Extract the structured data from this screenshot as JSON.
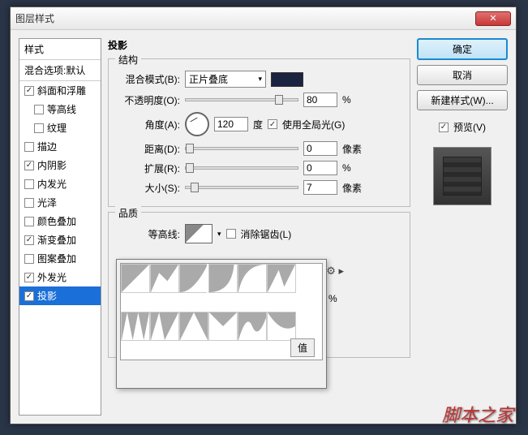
{
  "dialog": {
    "title": "图层样式"
  },
  "styles_panel": {
    "header": "样式",
    "blend_options": "混合选项:默认",
    "items": [
      {
        "label": "斜面和浮雕",
        "checked": true,
        "indent": false
      },
      {
        "label": "等高线",
        "checked": false,
        "indent": true
      },
      {
        "label": "纹理",
        "checked": false,
        "indent": true
      },
      {
        "label": "描边",
        "checked": false,
        "indent": false
      },
      {
        "label": "内阴影",
        "checked": true,
        "indent": false
      },
      {
        "label": "内发光",
        "checked": false,
        "indent": false
      },
      {
        "label": "光泽",
        "checked": false,
        "indent": false
      },
      {
        "label": "颜色叠加",
        "checked": false,
        "indent": false
      },
      {
        "label": "渐变叠加",
        "checked": true,
        "indent": false
      },
      {
        "label": "图案叠加",
        "checked": false,
        "indent": false
      },
      {
        "label": "外发光",
        "checked": true,
        "indent": false
      },
      {
        "label": "投影",
        "checked": true,
        "indent": false,
        "selected": true
      }
    ]
  },
  "center": {
    "title": "投影",
    "structure": {
      "legend": "结构",
      "blend_mode_label": "混合模式(B):",
      "blend_mode_value": "正片叠底",
      "opacity_label": "不透明度(O):",
      "opacity_value": "80",
      "opacity_unit": "%",
      "angle_label": "角度(A):",
      "angle_value": "120",
      "angle_unit": "度",
      "use_global_light": "使用全局光(G)",
      "use_global_checked": true,
      "distance_label": "距离(D):",
      "distance_value": "0",
      "distance_unit": "像素",
      "spread_label": "扩展(R):",
      "spread_value": "0",
      "spread_unit": "%",
      "size_label": "大小(S):",
      "size_value": "7",
      "size_unit": "像素"
    },
    "quality": {
      "legend": "品质",
      "contour_label": "等高线:",
      "antialias_label": "消除锯齿(L)",
      "antialias_checked": false,
      "noise_unit": "%",
      "reset_btn": "值"
    }
  },
  "right": {
    "ok": "确定",
    "cancel": "取消",
    "new_style": "新建样式(W)...",
    "preview_label": "预览(V)",
    "preview_checked": true
  },
  "watermark": "脚本之家",
  "colors": {
    "swatch": "#1a2340",
    "accent": "#1a8acf"
  }
}
